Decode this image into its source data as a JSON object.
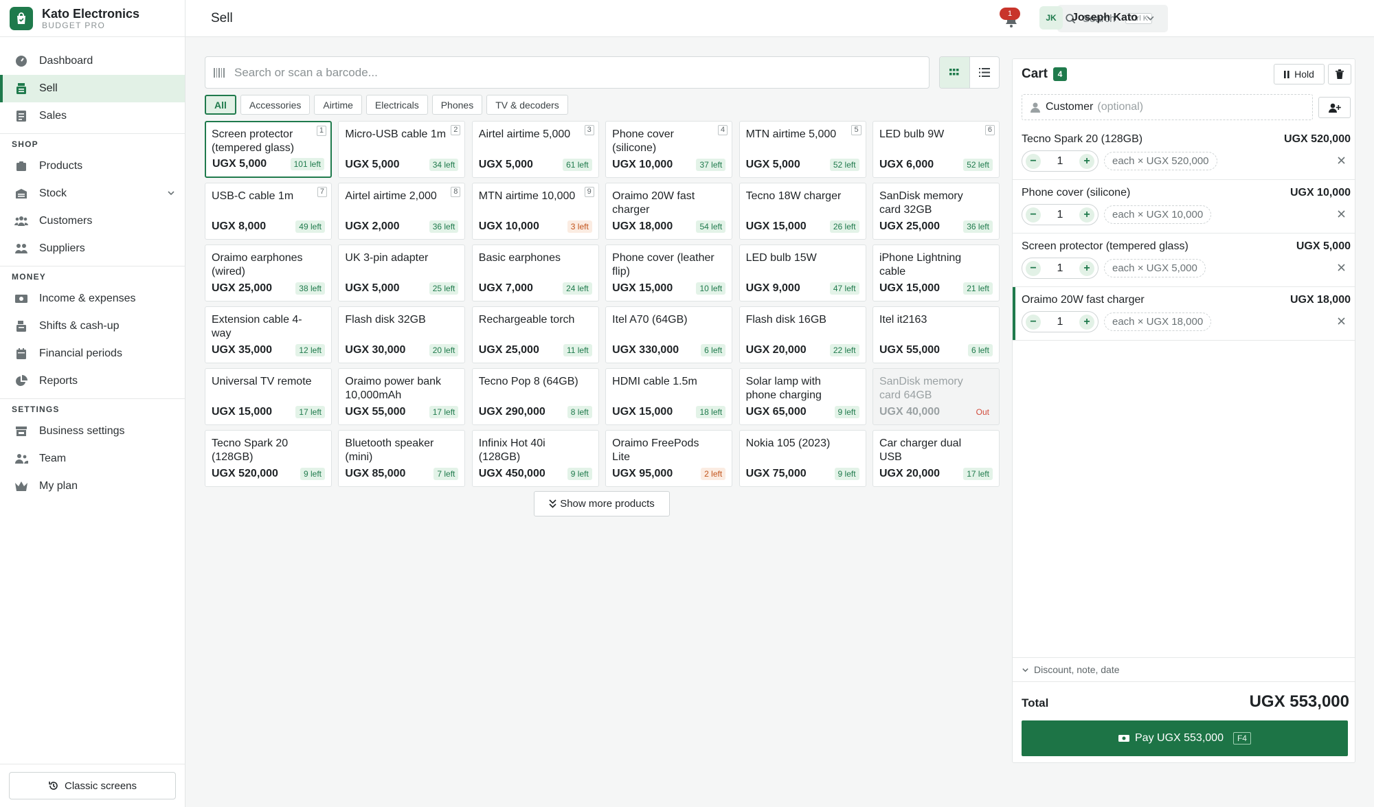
{
  "brand": {
    "name": "Kato Electronics",
    "subtitle": "BUDGET PRO"
  },
  "nav": {
    "dashboard": "Dashboard",
    "sell": "Sell",
    "sales": "Sales",
    "shop_section": "SHOP",
    "products": "Products",
    "stock": "Stock",
    "customers": "Customers",
    "suppliers": "Suppliers",
    "money_section": "MONEY",
    "income": "Income & expenses",
    "shifts": "Shifts & cash-up",
    "periods": "Financial periods",
    "reports": "Reports",
    "settings_section": "SETTINGS",
    "business": "Business settings",
    "team": "Team",
    "plan": "My plan",
    "classic": "Classic screens"
  },
  "topbar": {
    "title": "Sell",
    "search_label": "Search",
    "search_kbd": "Ctrl K",
    "notif_count": "1",
    "user_initials": "JK",
    "user_name": "Joseph Kato"
  },
  "search": {
    "placeholder": "Search or scan a barcode..."
  },
  "filters": [
    "All",
    "Accessories",
    "Airtime",
    "Electricals",
    "Phones",
    "TV & decoders"
  ],
  "products": [
    {
      "name": "Screen protector (tempered glass)",
      "price": "UGX 5,000",
      "stock": "101 left",
      "key": "1"
    },
    {
      "name": "Micro-USB cable 1m",
      "price": "UGX 5,000",
      "stock": "34 left",
      "key": "2"
    },
    {
      "name": "Airtel airtime 5,000",
      "price": "UGX 5,000",
      "stock": "61 left",
      "key": "3"
    },
    {
      "name": "Phone cover (silicone)",
      "price": "UGX 10,000",
      "stock": "37 left",
      "key": "4"
    },
    {
      "name": "MTN airtime 5,000",
      "price": "UGX 5,000",
      "stock": "52 left",
      "key": "5"
    },
    {
      "name": "LED bulb 9W",
      "price": "UGX 6,000",
      "stock": "52 left",
      "key": "6"
    },
    {
      "name": "USB-C cable 1m",
      "price": "UGX 8,000",
      "stock": "49 left",
      "key": "7"
    },
    {
      "name": "Airtel airtime 2,000",
      "price": "UGX 2,000",
      "stock": "36 left",
      "key": "8"
    },
    {
      "name": "MTN airtime 10,000",
      "price": "UGX 10,000",
      "stock": "3 left",
      "key": "9"
    },
    {
      "name": "Oraimo 20W fast charger",
      "price": "UGX 18,000",
      "stock": "54 left",
      "key": ""
    },
    {
      "name": "Tecno 18W charger",
      "price": "UGX 15,000",
      "stock": "26 left",
      "key": ""
    },
    {
      "name": "SanDisk memory card 32GB",
      "price": "UGX 25,000",
      "stock": "36 left",
      "key": ""
    },
    {
      "name": "Oraimo earphones (wired)",
      "price": "UGX 25,000",
      "stock": "38 left",
      "key": ""
    },
    {
      "name": "UK 3-pin adapter",
      "price": "UGX 5,000",
      "stock": "25 left",
      "key": ""
    },
    {
      "name": "Basic earphones",
      "price": "UGX 7,000",
      "stock": "24 left",
      "key": ""
    },
    {
      "name": "Phone cover (leather flip)",
      "price": "UGX 15,000",
      "stock": "10 left",
      "key": ""
    },
    {
      "name": "LED bulb 15W",
      "price": "UGX 9,000",
      "stock": "47 left",
      "key": ""
    },
    {
      "name": "iPhone Lightning cable",
      "price": "UGX 15,000",
      "stock": "21 left",
      "key": ""
    },
    {
      "name": "Extension cable 4-way",
      "price": "UGX 35,000",
      "stock": "12 left",
      "key": ""
    },
    {
      "name": "Flash disk 32GB",
      "price": "UGX 30,000",
      "stock": "20 left",
      "key": ""
    },
    {
      "name": "Rechargeable torch",
      "price": "UGX 25,000",
      "stock": "11 left",
      "key": ""
    },
    {
      "name": "Itel A70 (64GB)",
      "price": "UGX 330,000",
      "stock": "6 left",
      "key": ""
    },
    {
      "name": "Flash disk 16GB",
      "price": "UGX 20,000",
      "stock": "22 left",
      "key": ""
    },
    {
      "name": "Itel it2163",
      "price": "UGX 55,000",
      "stock": "6 left",
      "key": ""
    },
    {
      "name": "Universal TV remote",
      "price": "UGX 15,000",
      "stock": "17 left",
      "key": ""
    },
    {
      "name": "Oraimo power bank 10,000mAh",
      "price": "UGX 55,000",
      "stock": "17 left",
      "key": ""
    },
    {
      "name": "Tecno Pop 8 (64GB)",
      "price": "UGX 290,000",
      "stock": "8 left",
      "key": ""
    },
    {
      "name": "HDMI cable 1.5m",
      "price": "UGX 15,000",
      "stock": "18 left",
      "key": ""
    },
    {
      "name": "Solar lamp with phone charging",
      "price": "UGX 65,000",
      "stock": "9 left",
      "key": ""
    },
    {
      "name": "SanDisk memory card 64GB",
      "price": "UGX 40,000",
      "stock": "Out",
      "key": ""
    },
    {
      "name": "Tecno Spark 20 (128GB)",
      "price": "UGX 520,000",
      "stock": "9 left",
      "key": ""
    },
    {
      "name": "Bluetooth speaker (mini)",
      "price": "UGX 85,000",
      "stock": "7 left",
      "key": ""
    },
    {
      "name": "Infinix Hot 40i (128GB)",
      "price": "UGX 450,000",
      "stock": "9 left",
      "key": ""
    },
    {
      "name": "Oraimo FreePods Lite",
      "price": "UGX 95,000",
      "stock": "2 left",
      "key": ""
    },
    {
      "name": "Nokia 105 (2023)",
      "price": "UGX 75,000",
      "stock": "9 left",
      "key": ""
    },
    {
      "name": "Car charger dual USB",
      "price": "UGX 20,000",
      "stock": "17 left",
      "key": ""
    }
  ],
  "show_more": "Show more products",
  "cart": {
    "title": "Cart",
    "count": "4",
    "hold": "Hold",
    "customer_label": "Customer",
    "customer_optional": "(optional)",
    "lines": [
      {
        "name": "Tecno Spark 20 (128GB)",
        "total": "UGX 520,000",
        "qty": "1",
        "each": "each × UGX 520,000"
      },
      {
        "name": "Phone cover (silicone)",
        "total": "UGX 10,000",
        "qty": "1",
        "each": "each × UGX 10,000"
      },
      {
        "name": "Screen protector (tempered glass)",
        "total": "UGX 5,000",
        "qty": "1",
        "each": "each × UGX 5,000"
      },
      {
        "name": "Oraimo 20W fast charger",
        "total": "UGX 18,000",
        "qty": "1",
        "each": "each × UGX 18,000"
      }
    ],
    "discount_label": "Discount, note, date",
    "total_label": "Total",
    "total_value": "UGX 553,000",
    "pay_label": "Pay UGX 553,000",
    "pay_kbd": "F4"
  },
  "colors": {
    "accent": "#1f7a4c",
    "accent_light": "#e2f1e6",
    "danger": "#c8342b",
    "low_stock": "#c2541c"
  }
}
